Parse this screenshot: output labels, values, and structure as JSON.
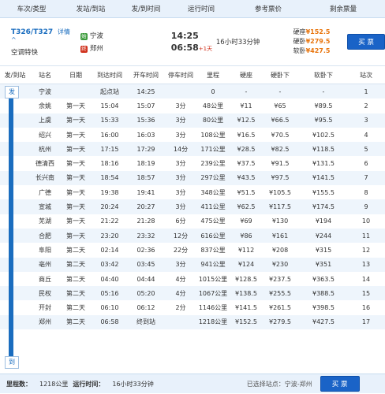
{
  "header": {
    "col_train": "车次/类型",
    "col_stations": "发站/到站",
    "col_times": "发/到时间",
    "col_duration": "运行时间",
    "col_price": "参考票价",
    "col_remaining": "剩余票量"
  },
  "train": {
    "code": "T326/T327",
    "detail_link": "详情",
    "type": "空调特快",
    "from_tag": "始",
    "from": "宁波",
    "to_tag": "终",
    "to": "郑州",
    "depart": "14:25",
    "arrive": "06:58",
    "plus_day": "+1天",
    "duration": "16小时33分钟",
    "prices": [
      {
        "label": "硬座",
        "value": "¥152.5"
      },
      {
        "label": "硬卧",
        "value": "¥279.5"
      },
      {
        "label": "软卧",
        "value": "¥427.5"
      }
    ],
    "buy_label": "买 票"
  },
  "stops_header": [
    "发/到站",
    "站名",
    "日期",
    "到达时间",
    "开车时间",
    "停车时间",
    "里程",
    "硬座",
    "硬卧下",
    "软卧下",
    "站次"
  ],
  "rail": {
    "start": "发",
    "end": "到"
  },
  "stops": [
    [
      "宁波",
      "",
      "起点站",
      "14:25",
      "",
      "0",
      "-",
      "-",
      "-",
      "1"
    ],
    [
      "余姚",
      "第一天",
      "15:04",
      "15:07",
      "3分",
      "48公里",
      "¥11",
      "¥65",
      "¥89.5",
      "2"
    ],
    [
      "上虞",
      "第一天",
      "15:33",
      "15:36",
      "3分",
      "80公里",
      "¥12.5",
      "¥66.5",
      "¥95.5",
      "3"
    ],
    [
      "绍兴",
      "第一天",
      "16:00",
      "16:03",
      "3分",
      "108公里",
      "¥16.5",
      "¥70.5",
      "¥102.5",
      "4"
    ],
    [
      "杭州",
      "第一天",
      "17:15",
      "17:29",
      "14分",
      "171公里",
      "¥28.5",
      "¥82.5",
      "¥118.5",
      "5"
    ],
    [
      "德清西",
      "第一天",
      "18:16",
      "18:19",
      "3分",
      "239公里",
      "¥37.5",
      "¥91.5",
      "¥131.5",
      "6"
    ],
    [
      "长兴南",
      "第一天",
      "18:54",
      "18:57",
      "3分",
      "297公里",
      "¥43.5",
      "¥97.5",
      "¥141.5",
      "7"
    ],
    [
      "广德",
      "第一天",
      "19:38",
      "19:41",
      "3分",
      "348公里",
      "¥51.5",
      "¥105.5",
      "¥155.5",
      "8"
    ],
    [
      "宣城",
      "第一天",
      "20:24",
      "20:27",
      "3分",
      "411公里",
      "¥62.5",
      "¥117.5",
      "¥174.5",
      "9"
    ],
    [
      "芜湖",
      "第一天",
      "21:22",
      "21:28",
      "6分",
      "475公里",
      "¥69",
      "¥130",
      "¥194",
      "10"
    ],
    [
      "合肥",
      "第一天",
      "23:20",
      "23:32",
      "12分",
      "616公里",
      "¥86",
      "¥161",
      "¥244",
      "11"
    ],
    [
      "阜阳",
      "第二天",
      "02:14",
      "02:36",
      "22分",
      "837公里",
      "¥112",
      "¥208",
      "¥315",
      "12"
    ],
    [
      "亳州",
      "第二天",
      "03:42",
      "03:45",
      "3分",
      "941公里",
      "¥124",
      "¥230",
      "¥351",
      "13"
    ],
    [
      "商丘",
      "第二天",
      "04:40",
      "04:44",
      "4分",
      "1015公里",
      "¥128.5",
      "¥237.5",
      "¥363.5",
      "14"
    ],
    [
      "民权",
      "第二天",
      "05:16",
      "05:20",
      "4分",
      "1067公里",
      "¥138.5",
      "¥255.5",
      "¥388.5",
      "15"
    ],
    [
      "开封",
      "第二天",
      "06:10",
      "06:12",
      "2分",
      "1146公里",
      "¥141.5",
      "¥261.5",
      "¥398.5",
      "16"
    ],
    [
      "郑州",
      "第二天",
      "06:58",
      "终到站",
      "",
      "1218公里",
      "¥152.5",
      "¥279.5",
      "¥427.5",
      "17"
    ]
  ],
  "footer": {
    "distance_label": "里程数：",
    "distance": "1218公里",
    "runtime_label": "运行时间：",
    "runtime": "16小时33分钟",
    "selected_label": "已选择站点：",
    "selected": "宁波-郑州",
    "buy_label": "买 票"
  }
}
